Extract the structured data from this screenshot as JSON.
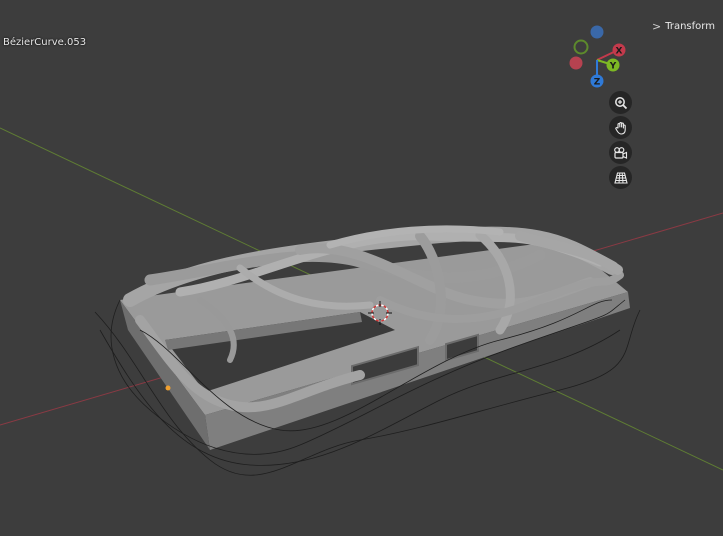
{
  "viewport": {
    "object_name": "BézierCurve.053",
    "sidebar_toggle": {
      "label": "Transform",
      "chevron": ">"
    }
  },
  "gizmo": {
    "axes": [
      {
        "axis": "X",
        "label": "X",
        "color": "#c33a4c"
      },
      {
        "axis": "Y",
        "label": "Y",
        "color": "#7db824"
      },
      {
        "axis": "Z",
        "label": "Z",
        "color": "#2f7ad8"
      },
      {
        "axis": "-X",
        "label": "",
        "color": "#b64250"
      },
      {
        "axis": "-Y",
        "label": "",
        "color": "#5d8a2c"
      },
      {
        "axis": "-Z",
        "label": "",
        "color": "#3a68a8"
      }
    ]
  },
  "nav_buttons": [
    {
      "id": "zoom",
      "icon": "zoom-icon"
    },
    {
      "id": "pan",
      "icon": "hand-pan-icon"
    },
    {
      "id": "camera",
      "icon": "camera-view-icon"
    },
    {
      "id": "ortho",
      "icon": "grid-perspective-icon"
    }
  ],
  "colors": {
    "background": "#3d3d3d",
    "axis_x_line": "#a23a46",
    "axis_y_line": "#6a8a3a",
    "mesh": "#8c8c8c"
  }
}
